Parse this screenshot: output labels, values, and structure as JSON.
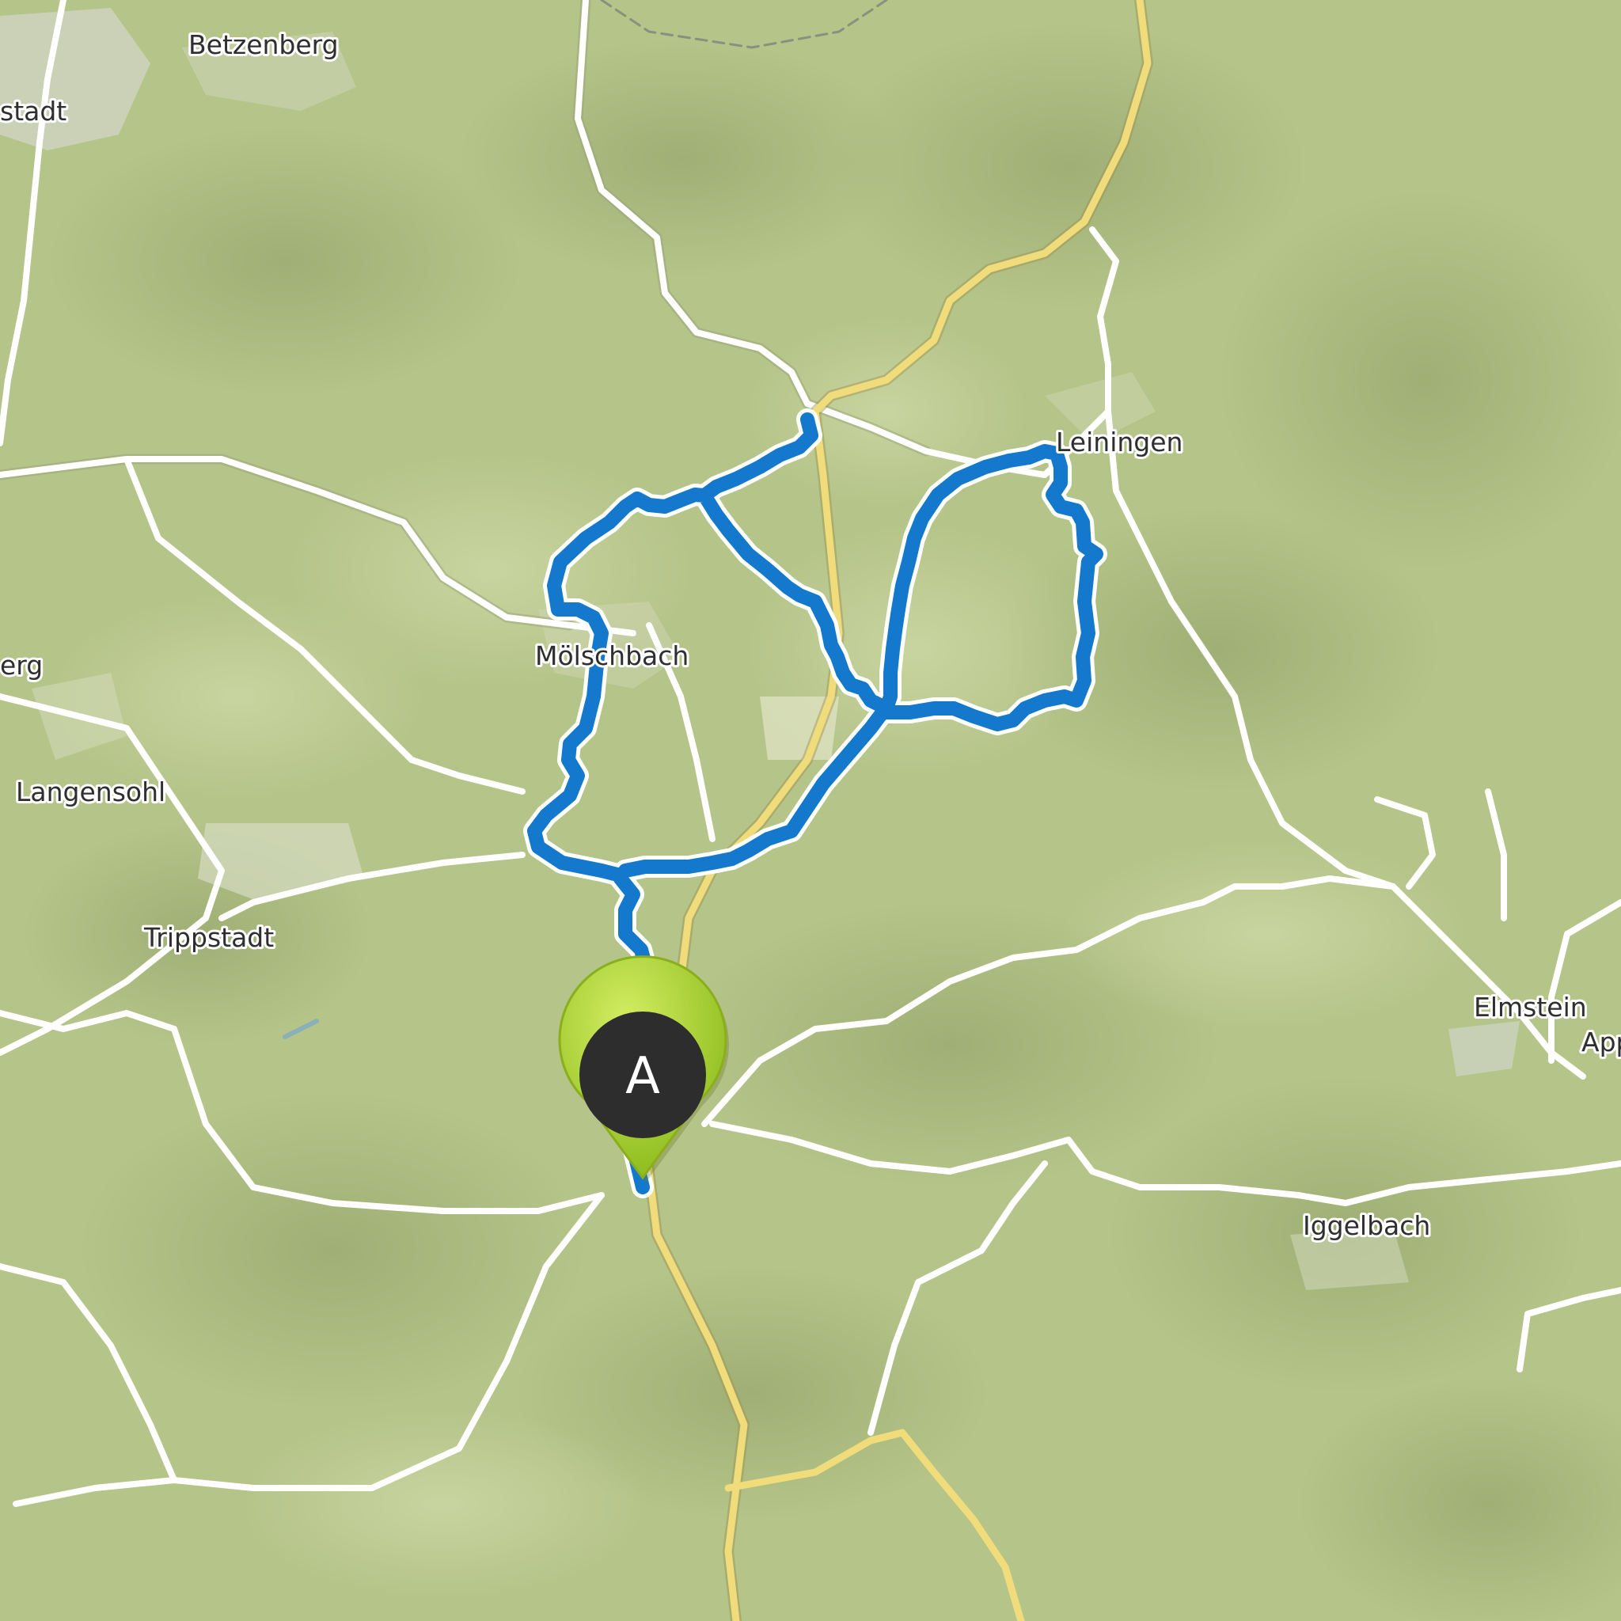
{
  "map": {
    "type": "topographic route map",
    "colors": {
      "terrain": "#b5c489",
      "route": "#1479cc",
      "road_minor": "#ffffff",
      "road_major": "#f0dc7a",
      "marker_outer": "#a6cf2e",
      "marker_inner": "#2d2d2d"
    }
  },
  "places": [
    {
      "id": "betzenberg",
      "label": "Betzenberg"
    },
    {
      "id": "stadt",
      "label": "stadt"
    },
    {
      "id": "erg",
      "label": "erg"
    },
    {
      "id": "langensohl",
      "label": "Langensohl"
    },
    {
      "id": "trippstadt",
      "label": "Trippstadt"
    },
    {
      "id": "moelbach",
      "label": "Mölschbach"
    },
    {
      "id": "leiningen",
      "label": "Leiningen"
    },
    {
      "id": "elmstein",
      "label": "Elmstein"
    },
    {
      "id": "appe",
      "label": "Appe"
    },
    {
      "id": "iggelbach",
      "label": "Iggelbach"
    }
  ],
  "marker": {
    "letter": "A",
    "icon": "start-pin-icon"
  }
}
